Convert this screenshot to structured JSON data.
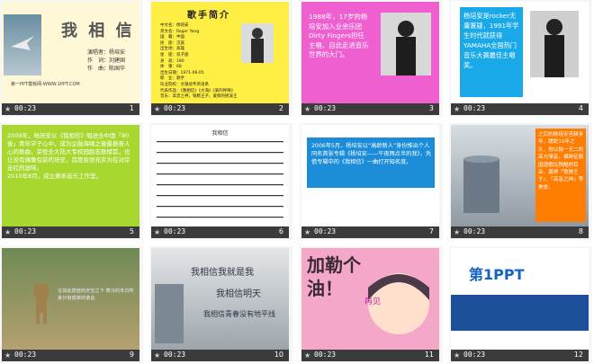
{
  "slides": [
    {
      "num": "1",
      "time": "00:23",
      "title": "我 相 信",
      "credits": [
        "演唱者：杨培安",
        "作　词：刘建国",
        "作　曲：陈国华"
      ],
      "footer": "第一PPT模板网-WWW.1PPT.COM"
    },
    {
      "num": "2",
      "time": "00:23",
      "heading": "歌手简介",
      "lines": [
        "中文名：杨培安",
        "英文名：Roger Yang",
        "国　籍：中国",
        "民　族：汉族",
        "出生地：高雄",
        "星　座：双子座",
        "身　高：180",
        "体　重：68",
        "出生日期：1971-06-05",
        "职　业：歌手",
        "毕业院校：文藻语专英语系",
        "代表作品：《我相信》《大海》《爱的呼唤》",
        "音乐：高音之神，铁肺王子，爱情的摇滚王"
      ]
    },
    {
      "num": "3",
      "time": "00:23",
      "text": "1988年，17岁的杨培安加入业余乐团Dirty Fingers担任主唱，自此走进音乐世界的大门。"
    },
    {
      "num": "4",
      "time": "00:23",
      "text": "杨培安是rocker无庸置疑，1991年学生时代就获得YAMAHA全国热门音乐大赛最佳主唱奖。"
    },
    {
      "num": "5",
      "time": "00:23",
      "text": "2009年，杨培安以《我相信》唱进全中国「80後」青年学子心中，成为企融海啸之後最振奋人心的歌曲，荣登全大陆大专校园励志歌榜首，也让没有偶像包装的培安，首度尝到充实为在对岸走红的滋味。",
      "text2": "2010年8月，成立黄禾音乐工作室。"
    },
    {
      "num": "6",
      "time": "00:23",
      "sheet_title": "我相信"
    },
    {
      "num": "7",
      "time": "00:23",
      "text": "2006年5月，杨培安以“高龄新人”身份推出个人同名首张专辑《杨培安——午夜两点半的我》，凭借专辑中的《我相信》一曲打开知名度。"
    },
    {
      "num": "8",
      "time": "00:23",
      "text": "之后的杨培安苦耕多年，蹉跎15年之久，他以独一无二的高亢嗓音，横跨征服国语歌坛残酷的耳朵，赢得『铁肺王子』、『高音之神』等美誉。"
    },
    {
      "num": "9",
      "time": "00:23",
      "text": "在如此蔚蓝的天空之下 寒冷的冬日吹来只有孤单的彼此"
    },
    {
      "num": "10",
      "time": "00:23",
      "lines": [
        "我相信我就是我",
        "我相信明天",
        "我相信青春没有地平线"
      ]
    },
    {
      "num": "11",
      "time": "00:23",
      "title": "加勒个油！",
      "tag": "再见"
    },
    {
      "num": "12",
      "time": "00:23",
      "logo": "第1PPT",
      "logo_num": "1"
    }
  ],
  "colors": {
    "bar": "#3b3b3b",
    "slide1_bg": "#fff8d6",
    "slide2_bg": "#ffee44",
    "slide3_bg": "#ef5fd0",
    "slide4_bg": "#ffffff",
    "slide5_bg": "#a8d830",
    "slide7_bg": "#ffffff",
    "accent_title": "#d01010"
  }
}
